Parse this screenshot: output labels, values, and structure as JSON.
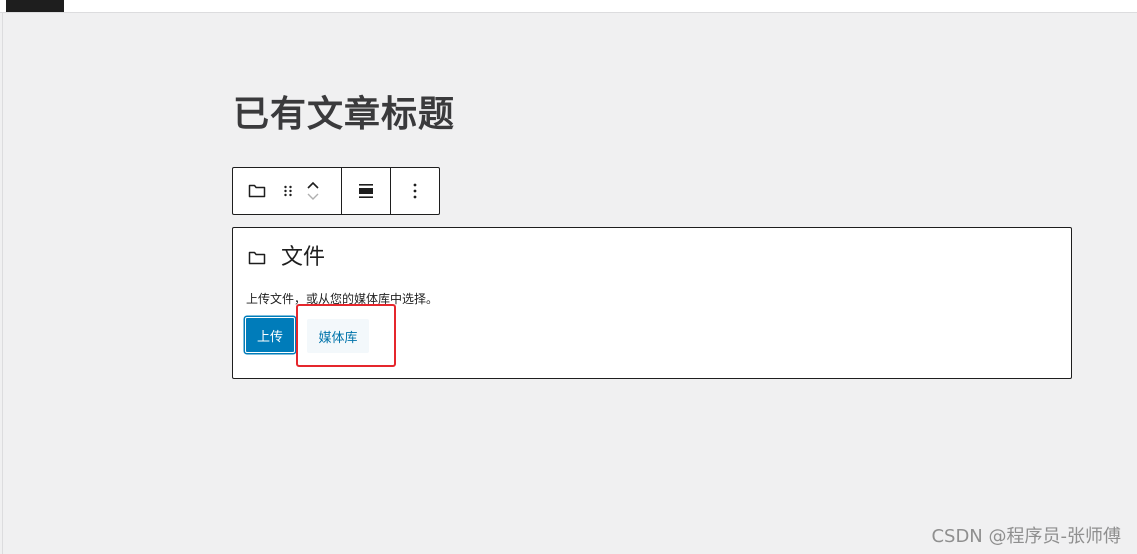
{
  "post_title": "已有文章标题",
  "block": {
    "title": "文件",
    "description": "上传文件，或从您的媒体库中选择。",
    "upload_label": "上传",
    "media_label": "媒体库"
  },
  "watermark": "CSDN @程序员-张师傅",
  "colors": {
    "primary": "#007cba",
    "highlight": "#e5262c",
    "background": "#f0f0f1"
  },
  "icons": {
    "block_type": "folder-icon",
    "drag": "drag-handle-icon",
    "move": "move-up-down-icon",
    "align": "align-center-icon",
    "options": "more-vertical-icon"
  }
}
